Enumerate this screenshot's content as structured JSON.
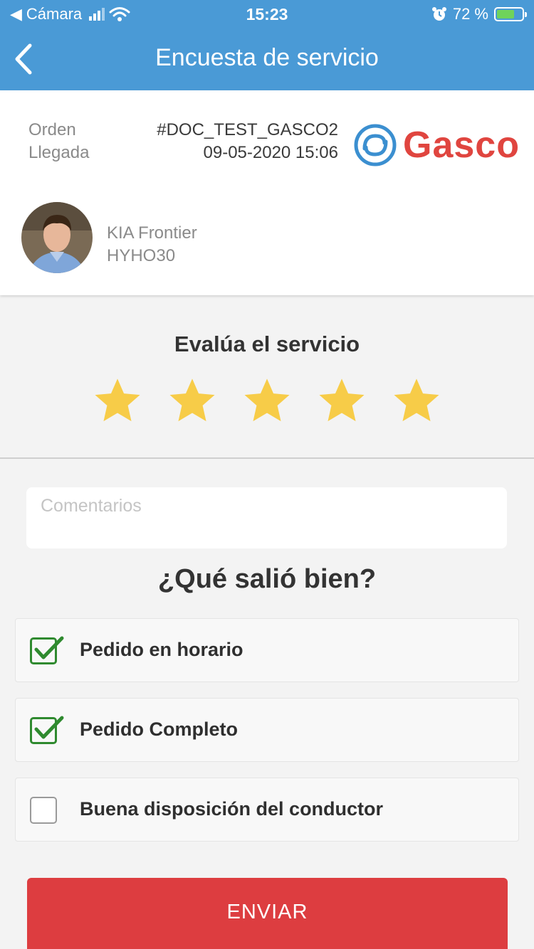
{
  "status_bar": {
    "back_app": "Cámara",
    "time": "15:23",
    "battery": "72 %",
    "battery_level": 0.72
  },
  "nav": {
    "title": "Encuesta de servicio"
  },
  "order": {
    "label_order": "Orden",
    "label_arrival": "Llegada",
    "order_id": "#DOC_TEST_GASCO2",
    "arrival": "09-05-2020 15:06",
    "brand": "Gasco"
  },
  "driver": {
    "vehicle": "KIA Frontier",
    "plate": "HYHO30"
  },
  "rating": {
    "title": "Evalúa el servicio",
    "value": 5,
    "max": 5,
    "star_color": "#f7cc48"
  },
  "comments": {
    "placeholder": "Comentarios",
    "value": ""
  },
  "good": {
    "title": "¿Qué salió bien?",
    "options": [
      {
        "label": "Pedido en horario",
        "checked": true
      },
      {
        "label": "Pedido Completo",
        "checked": true
      },
      {
        "label": "Buena disposición del conductor",
        "checked": false
      }
    ]
  },
  "submit_label": "ENVIAR",
  "colors": {
    "header": "#4a9ad6",
    "submit": "#dd3d40",
    "check": "#2f8a2f",
    "brand": "#e0453f"
  }
}
